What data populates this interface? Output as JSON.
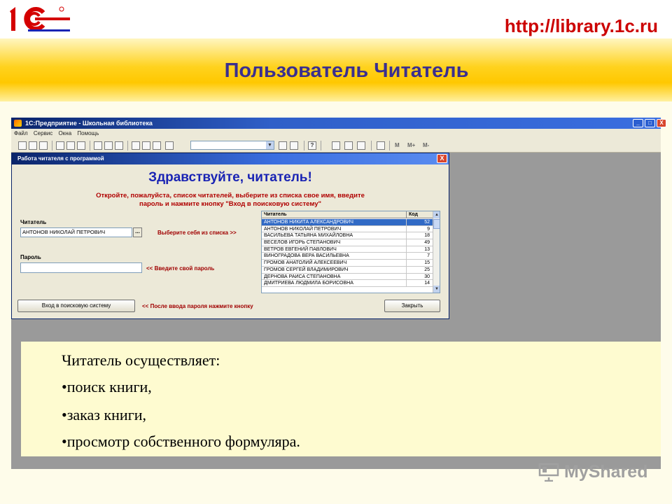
{
  "header": {
    "url": "http://library.1c.ru",
    "title": "Пользователь Читатель"
  },
  "app": {
    "title": "1С:Предприятие - Школьная библиотека",
    "menu": [
      "Файл",
      "Сервис",
      "Окна",
      "Помощь"
    ],
    "toolbar_text": [
      "M",
      "M+",
      "M-"
    ],
    "window_buttons": [
      "_",
      "□",
      "X"
    ]
  },
  "dialog": {
    "title": "Работа читателя с программой",
    "close": "X",
    "heading": "Здравствуйте, читатель!",
    "instruction_1": "Откройте, пожалуйста, список читателей, выберите из списка свое имя, введите",
    "instruction_2": "пароль и нажмите кнопку \"Вход в поисковую систему\"",
    "reader_label": "Читатель",
    "reader_value": "АНТОНОВ НИКОЛАЙ ПЕТРОВИЧ",
    "select_button": "...",
    "select_hint": "Выберите себя из списка >>",
    "password_label": "Пароль",
    "password_value": "",
    "password_hint": "<< Введите свой пароль",
    "login_button": "Вход в поисковую систему",
    "login_hint": "<< После ввода пароля нажмите кнопку",
    "close_button": "Закрыть",
    "list": {
      "col_name": "Читатель",
      "col_code": "Код",
      "rows": [
        {
          "name": "АНТОНОВ НИКИТА АЛЕКСАНДРОВИЧ",
          "code": "52"
        },
        {
          "name": "АНТОНОВ НИКОЛАЙ ПЕТРОВИЧ",
          "code": "9"
        },
        {
          "name": "ВАСИЛЬЕВА ТАТЬЯНА МИХАЙЛОВНА",
          "code": "18"
        },
        {
          "name": "ВЕСЕЛОВ ИГОРЬ СТЕПАНОВИЧ",
          "code": "49"
        },
        {
          "name": "ВЕТРОВ ЕВГЕНИЙ ПАВЛОВИЧ",
          "code": "13"
        },
        {
          "name": "ВИНОГРАДОВА ВЕРА ВАСИЛЬЕВНА",
          "code": "7"
        },
        {
          "name": "ГРОМОВ АНАТОЛИЙ АЛЕКСЕЕВИЧ",
          "code": "15"
        },
        {
          "name": "ГРОМОВ СЕРГЕЙ ВЛАДИМИРОВИЧ",
          "code": "25"
        },
        {
          "name": "ДЕРНОВА РАИСА СТЕПАНОВНА",
          "code": "30"
        },
        {
          "name": "ДМИТРИЕВА ЛЮДМИЛА БОРИСОВНА",
          "code": "14"
        }
      ]
    }
  },
  "text": {
    "lead": "Читатель осуществляет:",
    "items": [
      "•поиск книги,",
      "•заказ книги,",
      "•просмотр собственного формуляра."
    ]
  },
  "watermark": "MyShared"
}
